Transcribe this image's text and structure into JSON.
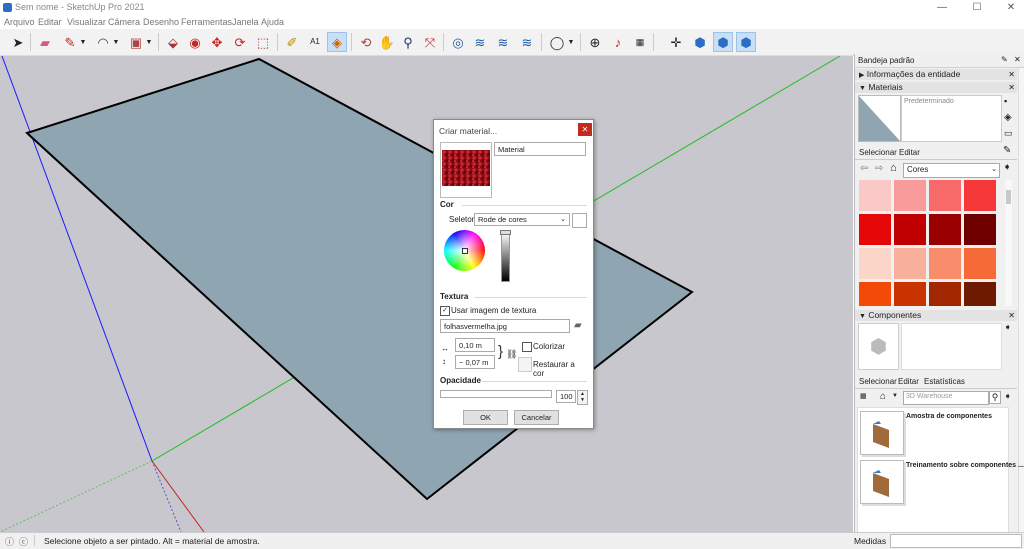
{
  "window": {
    "title": "Sem nome - SketchUp Pro 2021",
    "minimize": "—",
    "maximize": "☐",
    "close": "✕"
  },
  "menu": [
    "Arquivo",
    "Editar",
    "Visualizar",
    "Câmera",
    "Desenho",
    "Ferramentas",
    "Janela",
    "Ajuda"
  ],
  "tray": {
    "title": "Bandeja padrão",
    "entity_info": "Informações da entidade",
    "materials": {
      "header": "Materiais",
      "current_name": "Predeterminado",
      "tabs": [
        "Selecionar",
        "Editar"
      ],
      "library": "Cores",
      "swatches": [
        "#fbc8c8",
        "#f99b9b",
        "#f86a6a",
        "#f53838",
        "#e60808",
        "#c00000",
        "#9b0000",
        "#6e0000",
        "#fbd6c8",
        "#f9b09b",
        "#f98c6a",
        "#f66a38",
        "#f44a08",
        "#c93300",
        "#a02700",
        "#6e1a00"
      ]
    },
    "components": {
      "header": "Componentes",
      "tabs": [
        "Selecionar",
        "Editar",
        "Estatísticas"
      ],
      "search_placeholder": "3D Warehouse",
      "items": [
        {
          "title": "Amostra de componentes"
        },
        {
          "title": "Treinamento sobre componentes ..."
        }
      ]
    }
  },
  "dialog": {
    "title": "Criar material...",
    "name_value": "Material",
    "color_section": "Cor",
    "selector_label": "Seletor:",
    "selector_value": "Rode de cores",
    "texture_section": "Textura",
    "use_texture_label": "Usar imagem de textura",
    "use_texture_checked": true,
    "texture_file": "folhasvermelha.jpg",
    "width_value": "0,10 m",
    "height_value": "~ 0,07 m",
    "colorize_label": "Colorizar",
    "restore_label_1": "Restaurar a",
    "restore_label_2": "cor",
    "opacity_section": "Opacidade",
    "opacity_value": "100",
    "ok_label": "OK",
    "cancel_label": "Cancelar"
  },
  "status": {
    "message": "Selecione objeto a ser pintado. Alt = material de amostra.",
    "measures_label": "Medidas"
  }
}
